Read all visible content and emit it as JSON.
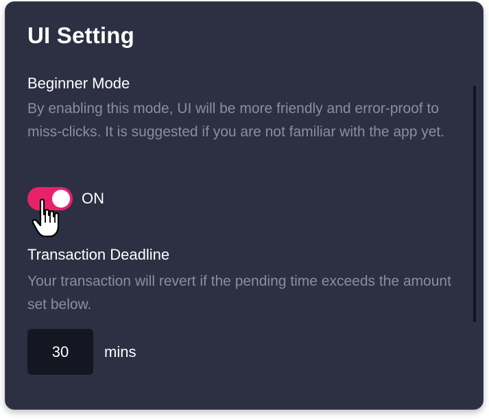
{
  "panel": {
    "title": "UI Setting"
  },
  "beginner_mode": {
    "label": "Beginner Mode",
    "description": "By enabling this mode, UI will be more friendly and error-proof to miss-clicks. It is suggested if you are not familiar with the app yet.",
    "toggle_state": "ON",
    "enabled": true,
    "accent_color": "#e8216b"
  },
  "transaction_deadline": {
    "label": "Transaction Deadline",
    "description": "Your transaction will revert if the pending time exceeds the amount set below.",
    "value": "30",
    "unit": "mins"
  },
  "icons": {
    "cursor": "hand-pointer-icon"
  }
}
